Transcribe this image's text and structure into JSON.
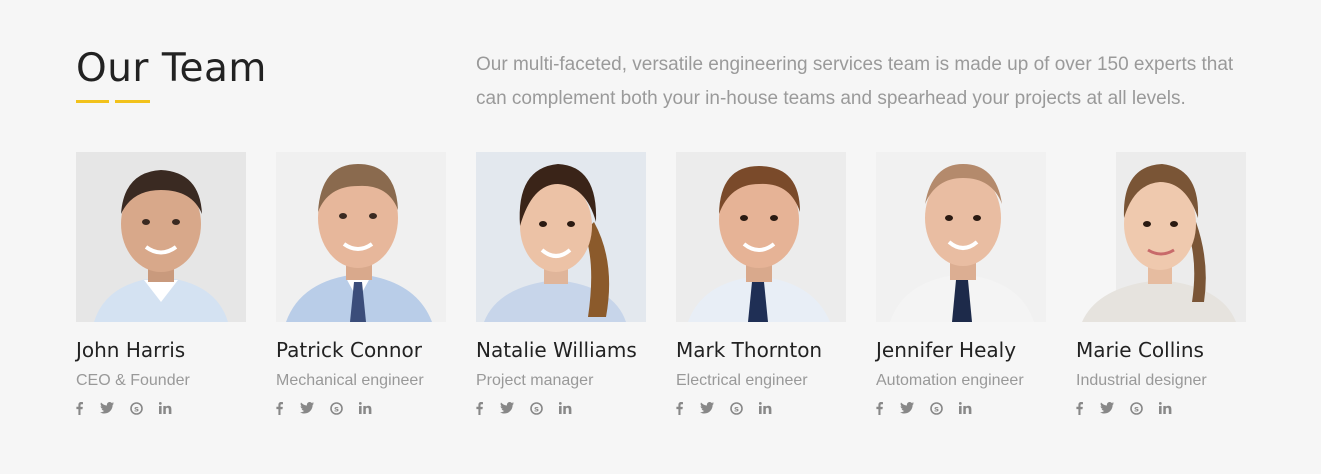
{
  "section": {
    "title": "Our Team",
    "intro": "Our multi-faceted, versatile engineering services team is made up of over 150 experts that can complement both your in-house teams and spearhead your projects at all levels.",
    "accent_color": "#f2c21b"
  },
  "members": [
    {
      "name": "John Harris",
      "role": "CEO & Founder"
    },
    {
      "name": "Patrick Connor",
      "role": "Mechanical engineer"
    },
    {
      "name": "Natalie Williams",
      "role": "Project manager"
    },
    {
      "name": "Mark Thornton",
      "role": "Electrical engineer"
    },
    {
      "name": "Jennifer Healy",
      "role": "Automation engineer"
    },
    {
      "name": "Marie Collins",
      "role": "Industrial designer"
    }
  ],
  "social_icons": [
    "facebook-icon",
    "twitter-icon",
    "skype-icon",
    "linkedin-icon"
  ]
}
